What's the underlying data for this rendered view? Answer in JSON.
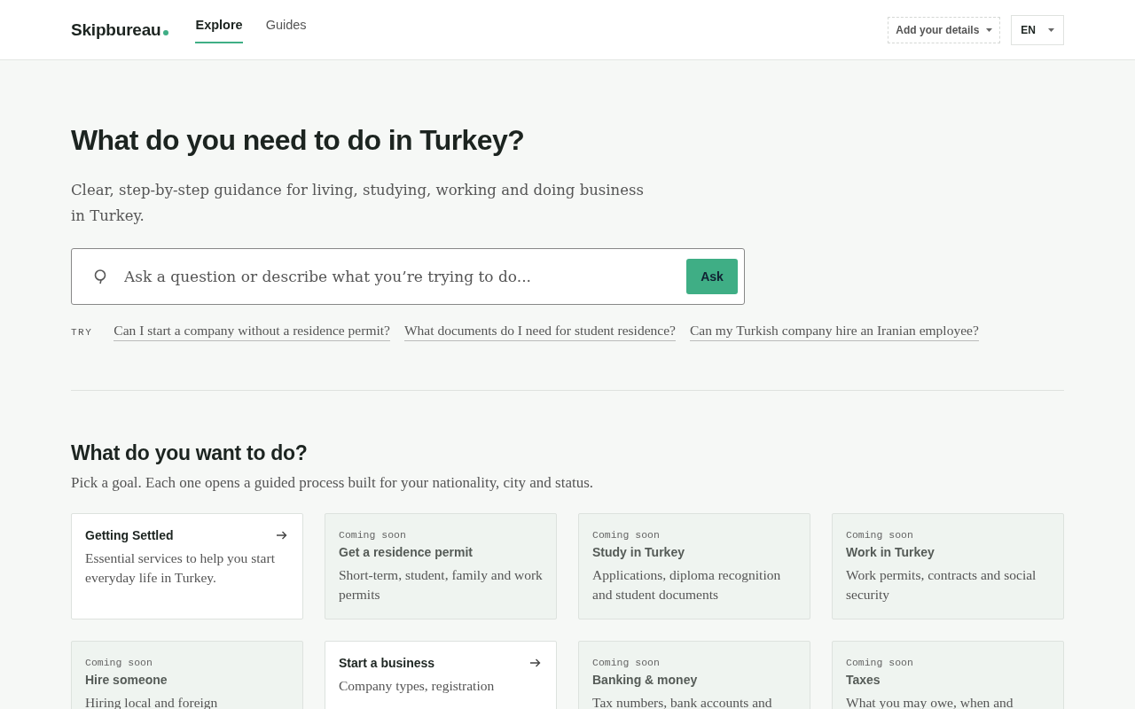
{
  "header": {
    "logo": "Skipbureau",
    "nav": [
      {
        "label": "Explore",
        "selected": true
      },
      {
        "label": "Guides",
        "selected": false
      }
    ],
    "details_button": "Add your details",
    "language": "EN"
  },
  "hero": {
    "title": "What do you need to do in Turkey?",
    "subtitle": "Clear, step-by-step guidance for living, studying, working and doing business in Turkey.",
    "search": {
      "placeholder": "Ask a question or describe what you’re trying to do...",
      "button": "Ask"
    },
    "try_label": "TRY",
    "suggestions": [
      "Can I start a company without a residence permit?",
      "What documents do I need for student residence?",
      "Can my Turkish company hire an Iranian employee?"
    ]
  },
  "goals": {
    "title": "What do you want to do?",
    "subtitle": "Pick a goal. Each one opens a guided process built for your nationality, city and status.",
    "cards": [
      {
        "kind": "available",
        "title": "Getting Settled",
        "description": "Essential services to help you start everyday life in Turkey."
      },
      {
        "kind": "coming_soon",
        "badge": "Coming soon",
        "title": "Get a residence permit",
        "description": "Short-term, student, family and work permits"
      },
      {
        "kind": "coming_soon",
        "badge": "Coming soon",
        "title": "Study in Turkey",
        "description": "Applications, diploma recognition and student documents"
      },
      {
        "kind": "coming_soon",
        "badge": "Coming soon",
        "title": "Work in Turkey",
        "description": "Work permits, contracts and social security"
      },
      {
        "kind": "coming_soon",
        "badge": "Coming soon",
        "title": "Hire someone",
        "description": "Hiring local and foreign"
      },
      {
        "kind": "available",
        "title": "Start a business",
        "description": "Company types, registration"
      },
      {
        "kind": "coming_soon",
        "badge": "Coming soon",
        "title": "Banking & money",
        "description": "Tax numbers, bank accounts and"
      },
      {
        "kind": "coming_soon",
        "badge": "Coming soon",
        "title": "Taxes",
        "description": "What you may owe, when and"
      }
    ]
  }
}
